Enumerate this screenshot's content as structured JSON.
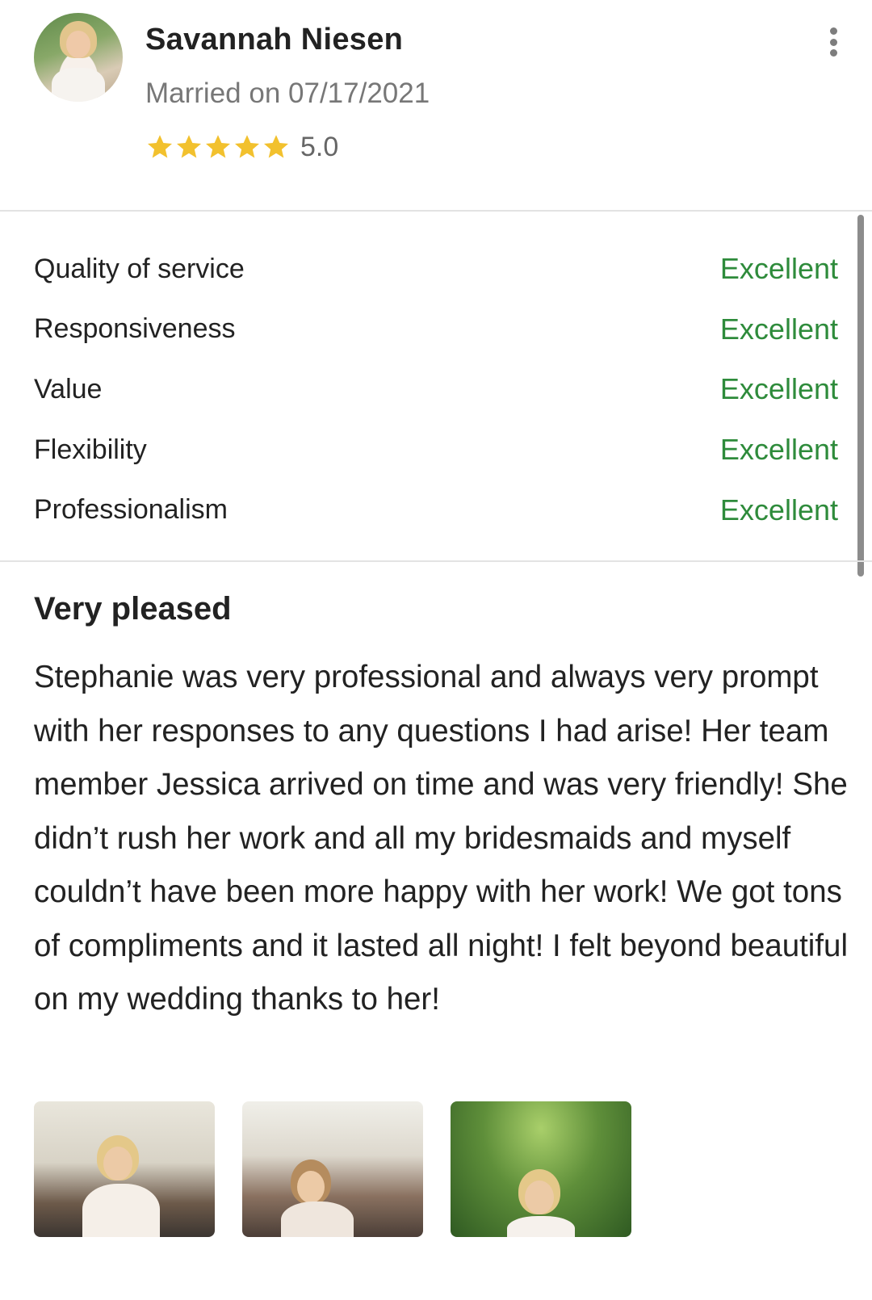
{
  "reviewer": {
    "name": "Savannah Niesen",
    "married_label": "Married on 07/17/2021",
    "rating_value": "5.0",
    "stars": 5,
    "star_color": "#f2c12e"
  },
  "ratings": [
    {
      "label": "Quality of service",
      "grade": "Excellent"
    },
    {
      "label": "Responsiveness",
      "grade": "Excellent"
    },
    {
      "label": "Value",
      "grade": "Excellent"
    },
    {
      "label": "Flexibility",
      "grade": "Excellent"
    },
    {
      "label": "Professionalism",
      "grade": "Excellent"
    }
  ],
  "review": {
    "title": "Very pleased",
    "body": "Stephanie was very professional and always very prompt with her responses to any questions I had arise! Her team member Jessica arrived on time and was very friendly! She didn’t rush her work and all my bridesmaids and myself couldn’t have been more happy with her work! We got tons of compliments and it lasted all night! I felt beyond beautiful on my wedding thanks to her!"
  },
  "colors": {
    "grade": "#2e8b3b",
    "muted": "#777777",
    "text": "#222222"
  },
  "icons": {
    "menu": "more-vertical-icon",
    "star": "star-icon"
  }
}
